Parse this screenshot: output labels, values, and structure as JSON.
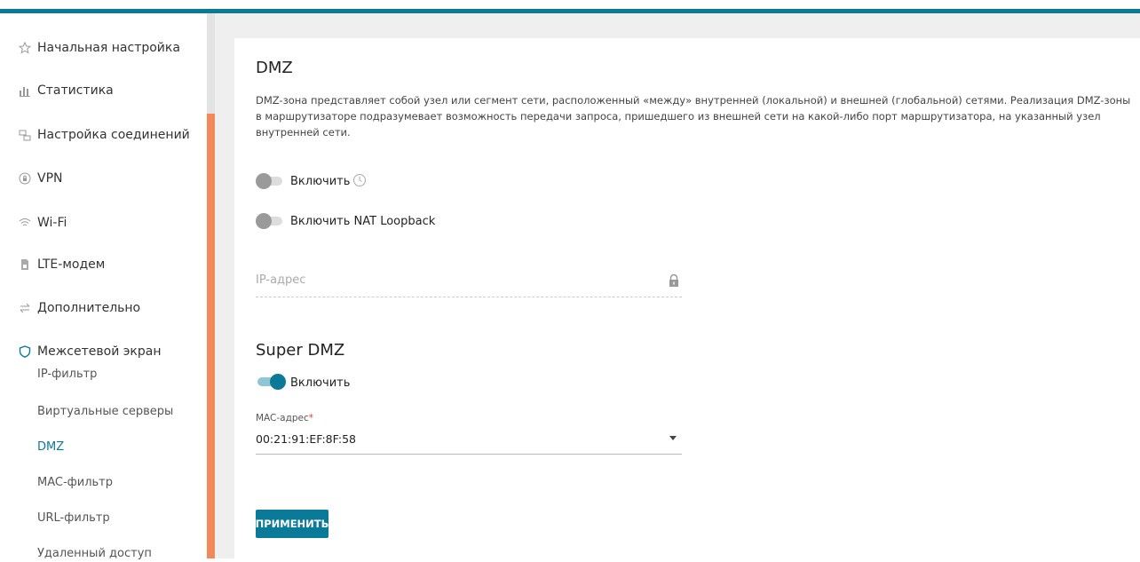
{
  "colors": {
    "accent": "#0b7a98",
    "sidebar_stripe": "#f2895a",
    "required": "#e53935"
  },
  "sidebar": {
    "items": [
      {
        "label": "Начальная настройка",
        "icon": "star-icon"
      },
      {
        "label": "Статистика",
        "icon": "bar-chart-icon"
      },
      {
        "label": "Настройка соединений",
        "icon": "network-icon"
      },
      {
        "label": "VPN",
        "icon": "lock-circle-icon"
      },
      {
        "label": "Wi-Fi",
        "icon": "wifi-icon"
      },
      {
        "label": "LTE-модем",
        "icon": "sim-card-icon"
      },
      {
        "label": "Дополнительно",
        "icon": "arrows-icon"
      },
      {
        "label": "Межсетевой экран",
        "icon": "shield-icon"
      }
    ],
    "subitems": [
      {
        "label": "IP-фильтр"
      },
      {
        "label": "Виртуальные серверы"
      },
      {
        "label": "DMZ",
        "active": true
      },
      {
        "label": "MAC-фильтр"
      },
      {
        "label": "URL-фильтр"
      },
      {
        "label": "Удаленный доступ"
      }
    ]
  },
  "main": {
    "title": "DMZ",
    "description": "DMZ-зона представляет собой узел или сегмент сети, расположенный «между» внутренней (локальной) и внешней (глобальной) сетями. Реализация DMZ-зоны в маршрутизаторе подразумевает возможность передачи запроса, пришедшего из внешней сети на какой-либо порт маршрутизатора, на указанный узел внутренней сети.",
    "enable_label": "Включить",
    "enable_on": false,
    "nat_loopback_label": "Включить NAT Loopback",
    "nat_loopback_on": false,
    "ip_placeholder": "IP-адрес",
    "super_dmz_title": "Super DMZ",
    "super_enable_label": "Включить",
    "super_enable_on": true,
    "mac_label": "MAC-адрес",
    "mac_required": "*",
    "mac_value": "00:21:91:EF:8F:58",
    "apply_label": "ПРИМЕНИТЬ"
  }
}
